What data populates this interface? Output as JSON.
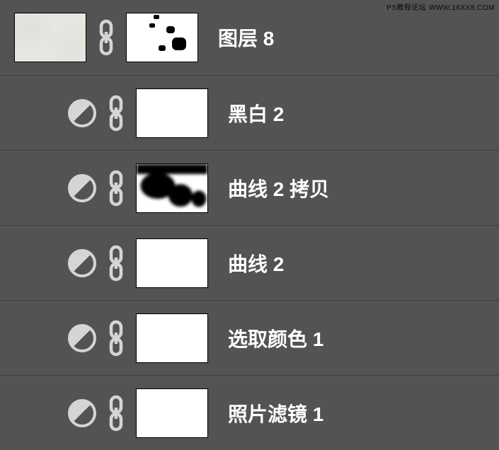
{
  "watermark": "PS教程论坛 WWW.16XX8.COM",
  "layers": [
    {
      "name": "图层 8",
      "hasAdjustIcon": false,
      "thumbType": "texture",
      "maskType": "blobs"
    },
    {
      "name": "黑白 2",
      "hasAdjustIcon": true,
      "thumbType": null,
      "maskType": "white"
    },
    {
      "name": "曲线 2 拷贝",
      "hasAdjustIcon": true,
      "thumbType": null,
      "maskType": "bigblobs"
    },
    {
      "name": "曲线 2",
      "hasAdjustIcon": true,
      "thumbType": null,
      "maskType": "white"
    },
    {
      "name": "选取颜色 1",
      "hasAdjustIcon": true,
      "thumbType": null,
      "maskType": "white"
    },
    {
      "name": "照片滤镜 1",
      "hasAdjustIcon": true,
      "thumbType": null,
      "maskType": "white"
    }
  ]
}
